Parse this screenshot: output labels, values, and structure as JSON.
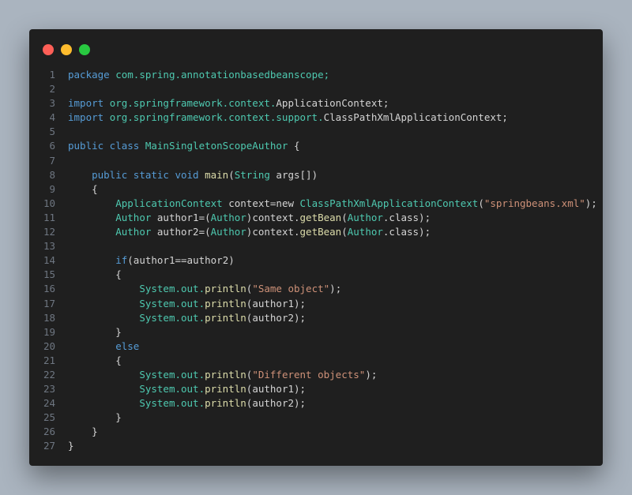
{
  "window": {
    "controls": {
      "close": "close",
      "minimize": "minimize",
      "maximize": "maximize"
    }
  },
  "code": {
    "lines": [
      {
        "no": "1",
        "tokens": [
          {
            "text": "package ",
            "cls": "kw"
          },
          {
            "text": "com.spring.annotationbasedbeanscope;",
            "cls": "ty"
          }
        ]
      },
      {
        "no": "2",
        "tokens": [
          {
            "text": "",
            "cls": "plain"
          }
        ]
      },
      {
        "no": "3",
        "tokens": [
          {
            "text": "import ",
            "cls": "kw"
          },
          {
            "text": "org.springframework.context.",
            "cls": "ty"
          },
          {
            "text": "ApplicationContext;",
            "cls": "plain"
          }
        ]
      },
      {
        "no": "4",
        "tokens": [
          {
            "text": "import ",
            "cls": "kw"
          },
          {
            "text": "org.springframework.context.support.",
            "cls": "ty"
          },
          {
            "text": "ClassPathXmlApplicationContext;",
            "cls": "plain"
          }
        ]
      },
      {
        "no": "5",
        "tokens": [
          {
            "text": "",
            "cls": "plain"
          }
        ]
      },
      {
        "no": "6",
        "tokens": [
          {
            "text": "public class ",
            "cls": "kw"
          },
          {
            "text": "MainSingletonScopeAuthor",
            "cls": "ty"
          },
          {
            "text": " {",
            "cls": "plain"
          }
        ]
      },
      {
        "no": "7",
        "tokens": [
          {
            "text": "",
            "cls": "plain"
          }
        ]
      },
      {
        "no": "8",
        "tokens": [
          {
            "text": "    ",
            "cls": "plain"
          },
          {
            "text": "public static void ",
            "cls": "kw"
          },
          {
            "text": "main",
            "cls": "fn"
          },
          {
            "text": "(",
            "cls": "plain"
          },
          {
            "text": "String",
            "cls": "ty"
          },
          {
            "text": " args[])",
            "cls": "plain"
          }
        ]
      },
      {
        "no": "9",
        "tokens": [
          {
            "text": "    {",
            "cls": "plain"
          }
        ]
      },
      {
        "no": "10",
        "tokens": [
          {
            "text": "        ",
            "cls": "plain"
          },
          {
            "text": "ApplicationContext",
            "cls": "ty"
          },
          {
            "text": " context=new ",
            "cls": "plain"
          },
          {
            "text": "ClassPathXmlApplicationContext",
            "cls": "ty"
          },
          {
            "text": "(",
            "cls": "plain"
          },
          {
            "text": "\"springbeans.xml\"",
            "cls": "str"
          },
          {
            "text": ");",
            "cls": "plain"
          }
        ]
      },
      {
        "no": "11",
        "tokens": [
          {
            "text": "        ",
            "cls": "plain"
          },
          {
            "text": "Author",
            "cls": "ty"
          },
          {
            "text": " author1=(",
            "cls": "plain"
          },
          {
            "text": "Author",
            "cls": "ty"
          },
          {
            "text": ")context.",
            "cls": "plain"
          },
          {
            "text": "getBean",
            "cls": "fn"
          },
          {
            "text": "(",
            "cls": "plain"
          },
          {
            "text": "Author",
            "cls": "ty"
          },
          {
            "text": ".class);",
            "cls": "plain"
          }
        ]
      },
      {
        "no": "12",
        "tokens": [
          {
            "text": "        ",
            "cls": "plain"
          },
          {
            "text": "Author",
            "cls": "ty"
          },
          {
            "text": " author2=(",
            "cls": "plain"
          },
          {
            "text": "Author",
            "cls": "ty"
          },
          {
            "text": ")context.",
            "cls": "plain"
          },
          {
            "text": "getBean",
            "cls": "fn"
          },
          {
            "text": "(",
            "cls": "plain"
          },
          {
            "text": "Author",
            "cls": "ty"
          },
          {
            "text": ".class);",
            "cls": "plain"
          }
        ]
      },
      {
        "no": "13",
        "tokens": [
          {
            "text": "",
            "cls": "plain"
          }
        ]
      },
      {
        "no": "14",
        "tokens": [
          {
            "text": "        ",
            "cls": "plain"
          },
          {
            "text": "if",
            "cls": "kw"
          },
          {
            "text": "(author1==author2)",
            "cls": "plain"
          }
        ]
      },
      {
        "no": "15",
        "tokens": [
          {
            "text": "        {",
            "cls": "plain"
          }
        ]
      },
      {
        "no": "16",
        "tokens": [
          {
            "text": "            ",
            "cls": "plain"
          },
          {
            "text": "System.out.",
            "cls": "ty"
          },
          {
            "text": "println",
            "cls": "fn"
          },
          {
            "text": "(",
            "cls": "plain"
          },
          {
            "text": "\"Same object\"",
            "cls": "str"
          },
          {
            "text": ");",
            "cls": "plain"
          }
        ]
      },
      {
        "no": "17",
        "tokens": [
          {
            "text": "            ",
            "cls": "plain"
          },
          {
            "text": "System.out.",
            "cls": "ty"
          },
          {
            "text": "println",
            "cls": "fn"
          },
          {
            "text": "(author1);",
            "cls": "plain"
          }
        ]
      },
      {
        "no": "18",
        "tokens": [
          {
            "text": "            ",
            "cls": "plain"
          },
          {
            "text": "System.out.",
            "cls": "ty"
          },
          {
            "text": "println",
            "cls": "fn"
          },
          {
            "text": "(author2);",
            "cls": "plain"
          }
        ]
      },
      {
        "no": "19",
        "tokens": [
          {
            "text": "        }",
            "cls": "plain"
          }
        ]
      },
      {
        "no": "20",
        "tokens": [
          {
            "text": "        ",
            "cls": "plain"
          },
          {
            "text": "else",
            "cls": "kw"
          }
        ]
      },
      {
        "no": "21",
        "tokens": [
          {
            "text": "        {",
            "cls": "plain"
          }
        ]
      },
      {
        "no": "22",
        "tokens": [
          {
            "text": "            ",
            "cls": "plain"
          },
          {
            "text": "System.out.",
            "cls": "ty"
          },
          {
            "text": "println",
            "cls": "fn"
          },
          {
            "text": "(",
            "cls": "plain"
          },
          {
            "text": "\"Different objects\"",
            "cls": "str"
          },
          {
            "text": ");",
            "cls": "plain"
          }
        ]
      },
      {
        "no": "23",
        "tokens": [
          {
            "text": "            ",
            "cls": "plain"
          },
          {
            "text": "System.out.",
            "cls": "ty"
          },
          {
            "text": "println",
            "cls": "fn"
          },
          {
            "text": "(author1);",
            "cls": "plain"
          }
        ]
      },
      {
        "no": "24",
        "tokens": [
          {
            "text": "            ",
            "cls": "plain"
          },
          {
            "text": "System.out.",
            "cls": "ty"
          },
          {
            "text": "println",
            "cls": "fn"
          },
          {
            "text": "(author2);",
            "cls": "plain"
          }
        ]
      },
      {
        "no": "25",
        "tokens": [
          {
            "text": "        }",
            "cls": "plain"
          }
        ]
      },
      {
        "no": "26",
        "tokens": [
          {
            "text": "    }",
            "cls": "plain"
          }
        ]
      },
      {
        "no": "27",
        "tokens": [
          {
            "text": "}",
            "cls": "plain"
          }
        ]
      }
    ]
  }
}
